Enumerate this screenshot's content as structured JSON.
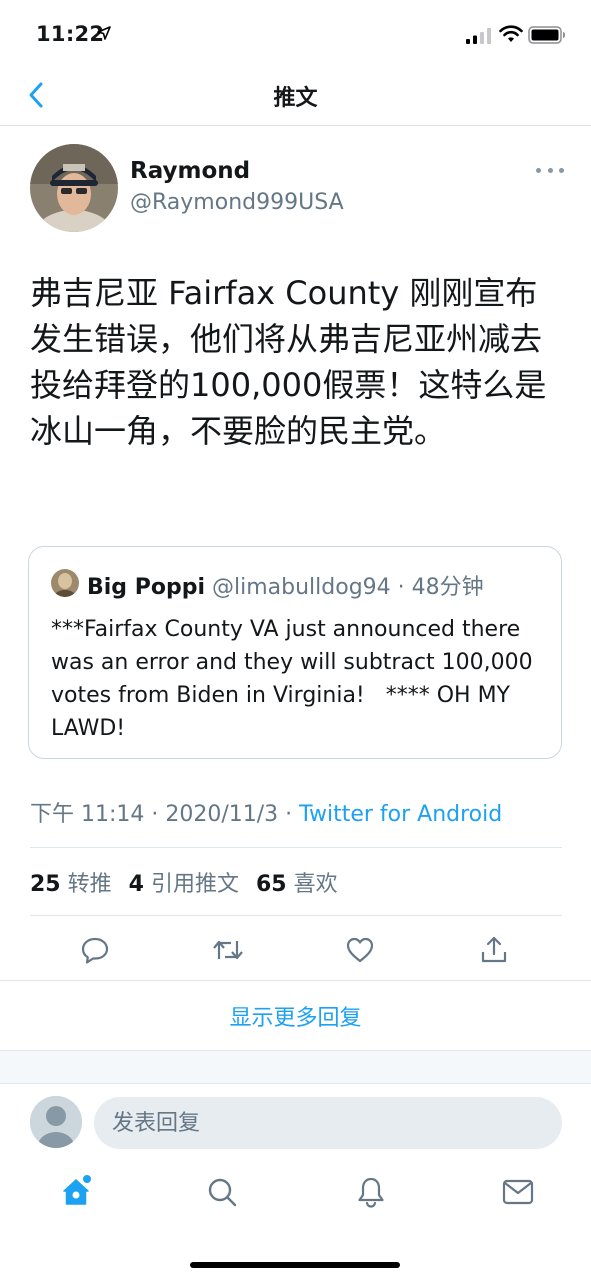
{
  "status_bar": {
    "time": "11:22"
  },
  "nav": {
    "title": "推文"
  },
  "tweet": {
    "author_name": "Raymond",
    "author_handle": "@Raymond999USA",
    "text": "弗吉尼亚 Fairfax County 刚刚宣布发生错误，他们将从弗吉尼亚州减去投给拜登的100,000假票！这特么是冰山一角，不要脸的民主党。",
    "timestamp": "下午 11:14 · 2020/11/3 · ",
    "source": "Twitter for Android"
  },
  "quote": {
    "name": "Big Poppi",
    "meta": " @limabulldog94 · 48分钟",
    "text": "***Fairfax County VA just announced there was an error and they will subtract 100,000 votes from Biden in Virginia!   **** OH MY LAWD!"
  },
  "stats": {
    "retweets_count": "25",
    "retweets_label": "转推",
    "quotes_count": "4",
    "quotes_label": "引用推文",
    "likes_count": "65",
    "likes_label": "喜欢"
  },
  "show_more_replies": "显示更多回复",
  "reply": {
    "placeholder": "发表回复"
  },
  "icons": {
    "back": "chevron-left-icon",
    "reply": "comment-icon",
    "retweet": "retweet-icon",
    "like": "heart-icon",
    "share": "share-icon",
    "home": "home-icon",
    "search": "search-icon",
    "notifications": "bell-icon",
    "messages": "mail-icon"
  },
  "colors": {
    "accent": "#1da1f2",
    "secondary_text": "#657786",
    "primary_text": "#14171a",
    "divider": "#e1e8ed"
  }
}
